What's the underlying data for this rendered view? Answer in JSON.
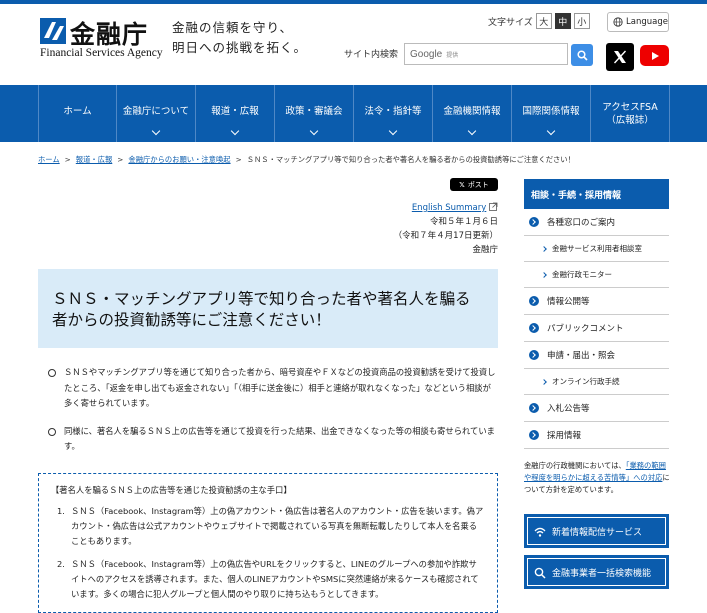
{
  "header": {
    "logo_jp": "金融庁",
    "logo_en": "Financial Services Agency",
    "tagline_line1": "金融の信頼を守り、",
    "tagline_line2": "明日への挑戦を拓く。",
    "fontsize_label": "文字サイズ",
    "fontsize_options": [
      "大",
      "中",
      "小"
    ],
    "fontsize_selected": "中",
    "language_label": "Language",
    "search_label": "サイト内検索",
    "search_google": "Google",
    "search_placeholder": "提供"
  },
  "nav": {
    "items": [
      {
        "label": "ホーム"
      },
      {
        "label": "金融庁について"
      },
      {
        "label": "報道・広報"
      },
      {
        "label": "政策・審議会"
      },
      {
        "label": "法令・指針等"
      },
      {
        "label": "金融機関情報"
      },
      {
        "label": "国際関係情報"
      },
      {
        "label": "アクセスFSA（広報誌）"
      }
    ]
  },
  "breadcrumb": {
    "items": [
      "ホーム",
      "報道・広報",
      "金融庁からのお願い・注意喚起"
    ],
    "current": "ＳＮＳ・マッチングアプリ等で知り合った者や著名人を騙る者からの投資勧誘等にご注意ください！"
  },
  "share_label": "ポスト",
  "meta": {
    "english_summary": "English Summary",
    "date": "令和５年１月６日",
    "updated": "（令和７年４月17日更新）",
    "org": "金融庁"
  },
  "article": {
    "title": "ＳＮＳ・マッチングアプリ等で知り合った者や著名人を騙る者からの投資勧誘等にご注意ください！",
    "paragraphs": [
      "ＳＮＳやマッチングアプリ等を通じて知り合った者から、暗号資産やＦＸなどの投資商品の投資勧誘を受けて投資したところ、「返金を申し出ても返金されない」「（相手に送金後に）相手と連絡が取れなくなった」などという相談が多く寄せられています。",
      "同様に、著名人を騙るＳＮＳ上の広告等を通じて投資を行った結果、出金できなくなった等の相談も寄せられています。"
    ],
    "box_heading": "【著名人を騙るＳＮＳ上の広告等を通じた投資勧誘の主な手口】",
    "box_items": [
      "ＳＮＳ（Facebook、Instagram等）上の偽アカウント・偽広告は著名人のアカウント・広告を装います。偽アカウント・偽広告は公式アカウントやウェブサイトで掲載されている写真を無断転載したりして本人を名乗ることもあります。",
      "ＳＮＳ（Facebook、Instagram等）上の偽広告やURLをクリックすると、LINEのグループへの参加や詐欺サイトへのアクセスを誘導されます。また、個人のLINEアカウントやSMSに突然連絡が来るケースも確認されています。多くの場合に犯人グループと個人間のやり取りに持ち込もうとしてきます。"
    ]
  },
  "sidebar": {
    "heading": "相談・手続・採用情報",
    "items": [
      {
        "label": "各種窓口のご案内",
        "sub": false
      },
      {
        "label": "金融サービス利用者相談室",
        "sub": true
      },
      {
        "label": "金融行政モニター",
        "sub": true
      },
      {
        "label": "情報公開等",
        "sub": false
      },
      {
        "label": "パブリックコメント",
        "sub": false
      },
      {
        "label": "申請・届出・照会",
        "sub": false
      },
      {
        "label": "オンライン行政手続",
        "sub": true
      },
      {
        "label": "入札公告等",
        "sub": false
      },
      {
        "label": "採用情報",
        "sub": false
      }
    ],
    "note_pre": "金融庁の行政機関においては、",
    "note_link": "「業務の範囲や程度を明らかに超える苦情等」への対応",
    "note_post": "について方針を定めています。",
    "buttons": [
      {
        "label": "新着情報配信サービス",
        "icon": "wifi-icon"
      },
      {
        "label": "金融事業者一括検索機能",
        "icon": "search-icon"
      }
    ]
  }
}
